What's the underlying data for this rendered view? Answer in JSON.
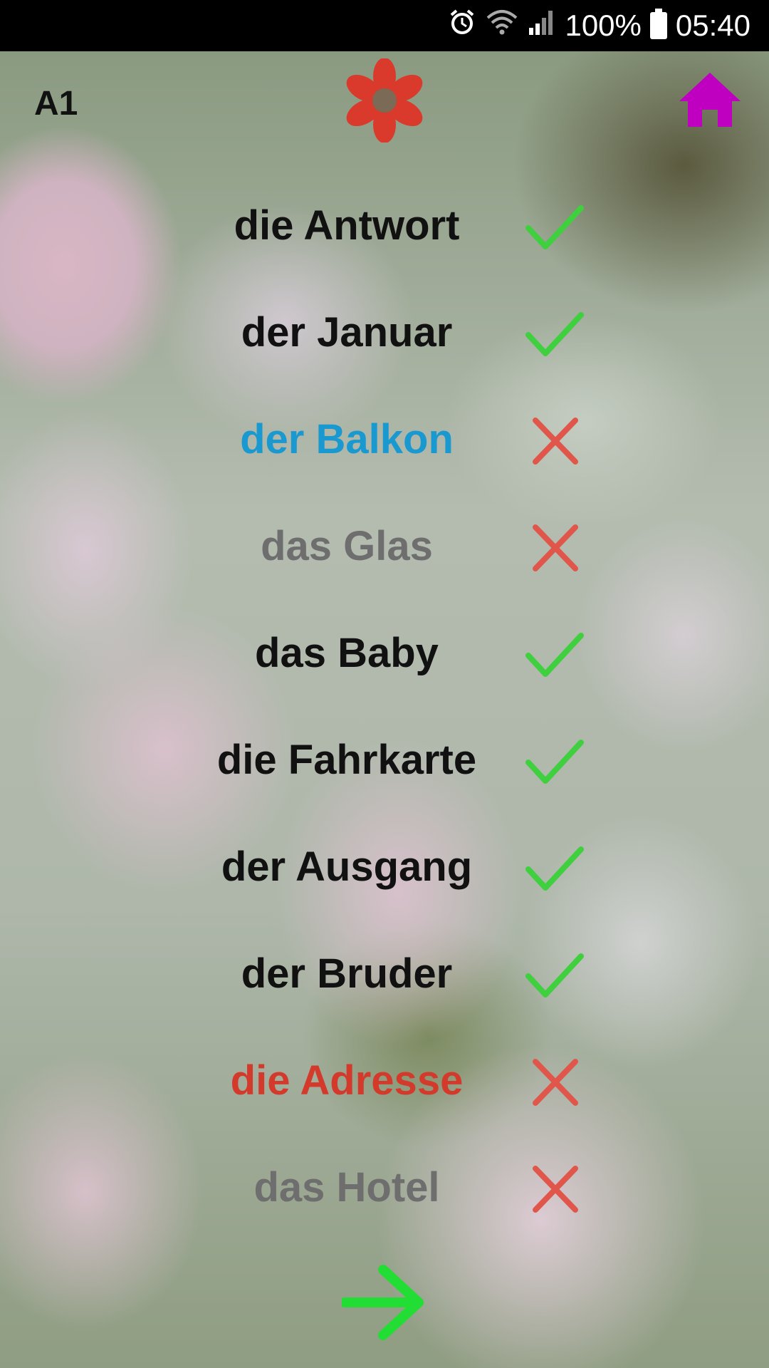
{
  "status_bar": {
    "battery_percent": "100%",
    "time": "05:40",
    "icons": [
      "alarm-icon",
      "wifi-icon",
      "signal-icon",
      "battery-icon"
    ]
  },
  "header": {
    "level": "A1",
    "center_icon": "flower-icon",
    "home_icon": "home-icon"
  },
  "colors": {
    "correct": "#3fcf3f",
    "wrong": "#e0564a",
    "home": "#c000c0",
    "flower": "#d93a2b",
    "next_arrow": "#22dd33",
    "word_default": "#111111",
    "word_blue": "#1a98d0",
    "word_gray": "#6e6e6e",
    "word_red": "#d33a2b"
  },
  "words": [
    {
      "text": "die Antwort",
      "color": "#111111",
      "result": "correct"
    },
    {
      "text": "der Januar",
      "color": "#111111",
      "result": "correct"
    },
    {
      "text": "der Balkon",
      "color": "#1a98d0",
      "result": "wrong"
    },
    {
      "text": "das Glas",
      "color": "#6e6e6e",
      "result": "wrong"
    },
    {
      "text": "das Baby",
      "color": "#111111",
      "result": "correct"
    },
    {
      "text": "die Fahrkarte",
      "color": "#111111",
      "result": "correct"
    },
    {
      "text": "der Ausgang",
      "color": "#111111",
      "result": "correct"
    },
    {
      "text": "der Bruder",
      "color": "#111111",
      "result": "correct"
    },
    {
      "text": "die Adresse",
      "color": "#d33a2b",
      "result": "wrong"
    },
    {
      "text": "das Hotel",
      "color": "#6e6e6e",
      "result": "wrong"
    }
  ],
  "next_icon": "arrow-right-icon"
}
